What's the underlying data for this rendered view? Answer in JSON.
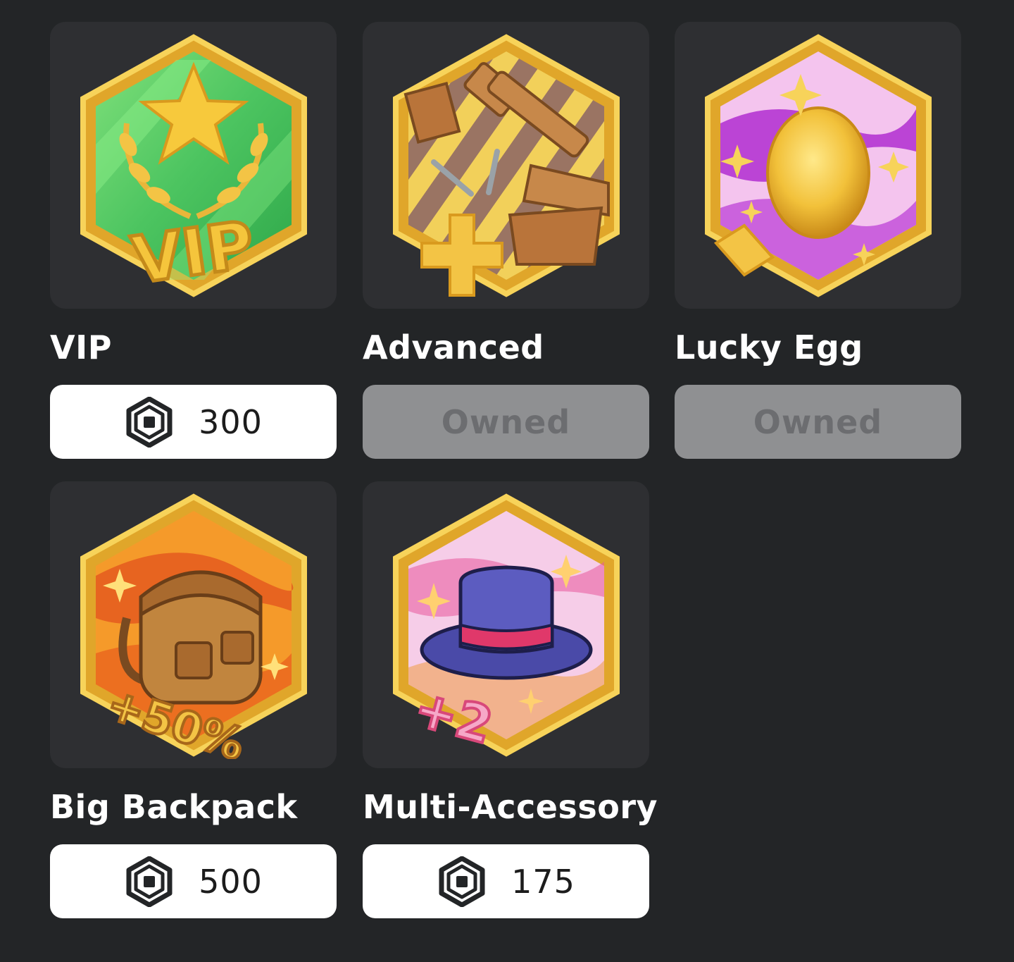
{
  "colors": {
    "background": "#232527",
    "card": "#2e2f32",
    "buy_button": "#ffffff",
    "owned_button": "#8f9092",
    "gold": "#f2c13a"
  },
  "currency_icon": "robux-icon",
  "items": [
    {
      "title": "VIP",
      "state": "buy",
      "price": "300",
      "badge_icon": "vip-star-badge-icon",
      "badge_text": "VIP"
    },
    {
      "title": "Advanced",
      "state": "owned",
      "owned_label": "Owned",
      "badge_icon": "hammer-nails-badge-icon"
    },
    {
      "title": "Lucky Egg",
      "state": "owned",
      "owned_label": "Owned",
      "badge_icon": "golden-egg-badge-icon"
    },
    {
      "title": "Big Backpack",
      "state": "buy",
      "price": "500",
      "badge_icon": "backpack-badge-icon",
      "badge_text": "+50%"
    },
    {
      "title": "Multi-Accessory",
      "state": "buy",
      "price": "175",
      "badge_icon": "top-hat-badge-icon",
      "badge_text": "+2"
    }
  ]
}
